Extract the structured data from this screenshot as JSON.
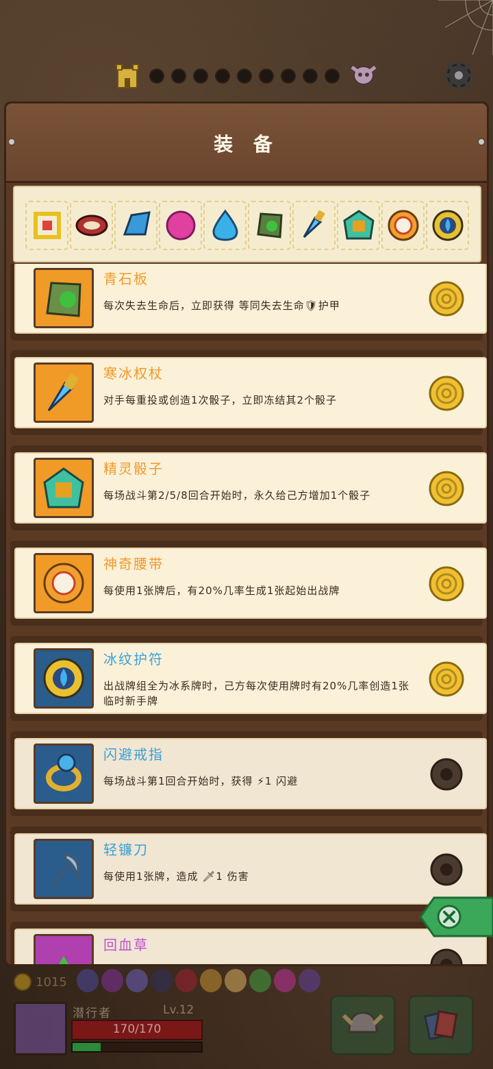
{
  "panel": {
    "title": "装 备"
  },
  "strip_icons": [
    "gem-frame-icon",
    "spiked-collar-icon",
    "blue-crystal-icon",
    "pink-blob-icon",
    "water-drop-icon",
    "green-stone-icon",
    "ice-scepter-icon",
    "spirit-dice-icon",
    "magic-belt-icon",
    "ice-amulet-icon"
  ],
  "items": [
    {
      "name": "青石板",
      "desc": "每次失去生命后，立即获得 等同失去生命🛡护甲",
      "color": "orange",
      "owned": true
    },
    {
      "name": "寒冰权杖",
      "desc": "对手每重投或创造1次骰子，立即冻结其2个骰子",
      "color": "orange",
      "owned": true
    },
    {
      "name": "精灵骰子",
      "desc": "每场战斗第2/5/8回合开始时，永久给己方增加1个骰子",
      "color": "orange",
      "owned": true
    },
    {
      "name": "神奇腰带",
      "desc": "每使用1张牌后，有20%几率生成1张起始出战牌",
      "color": "orange",
      "owned": true
    },
    {
      "name": "冰纹护符",
      "desc": "出战牌组全为冰系牌时，己方每次使用牌时有20%几率创造1张临时新手牌",
      "color": "blue",
      "owned": true
    },
    {
      "name": "闪避戒指",
      "desc": "每场战斗第1回合开始时，获得 ⚡1 闪避",
      "color": "blue",
      "owned": false
    },
    {
      "name": "轻镰刀",
      "desc": "每使用1张牌，造成 🗡1 伤害",
      "color": "blue",
      "owned": false
    },
    {
      "name": "回血草",
      "desc": "",
      "color": "purple",
      "owned": false
    }
  ],
  "hud": {
    "gold": "1015",
    "hero_name": "潜行者",
    "level": "Lv.12",
    "hp": "170/170",
    "xp_fraction": 0.22
  }
}
